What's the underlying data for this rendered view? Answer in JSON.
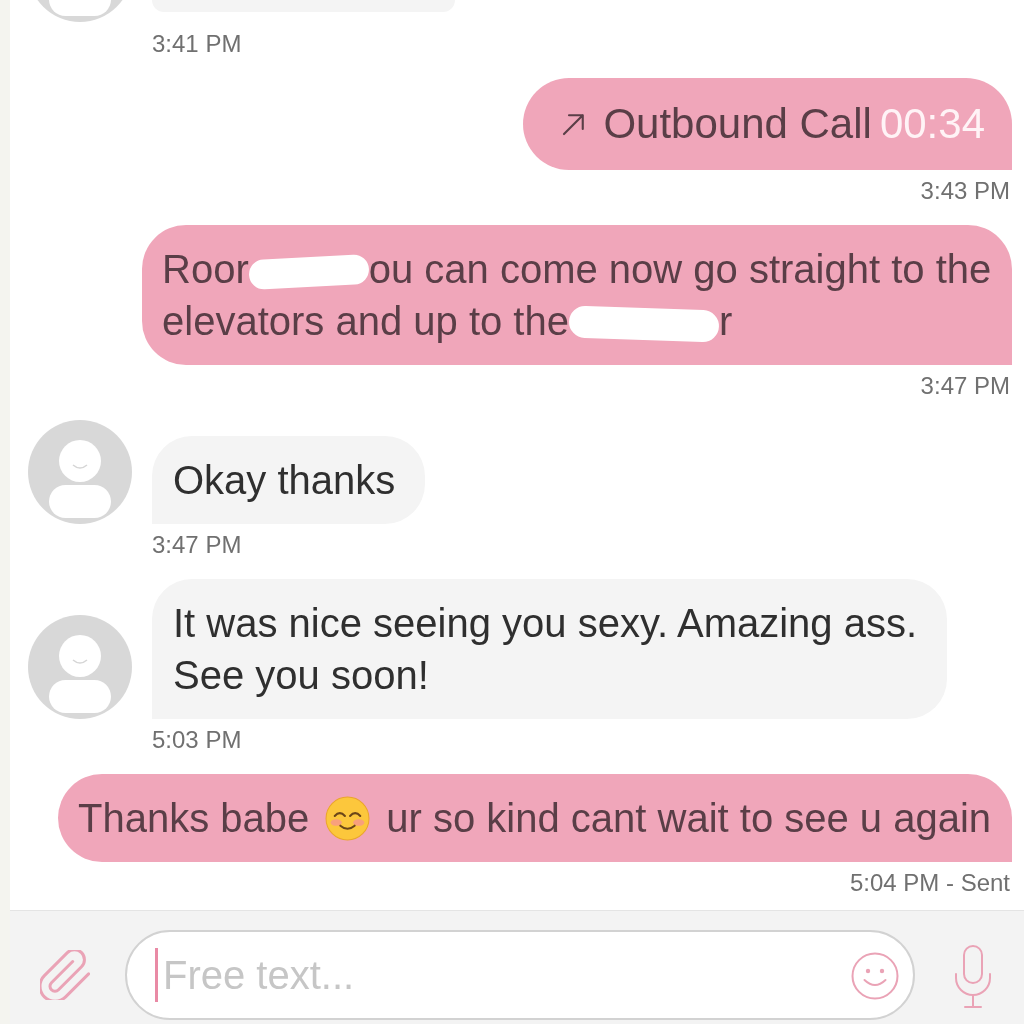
{
  "conversation": {
    "messages": [
      {
        "outgoing": false,
        "kind": "clipped",
        "time": "3:41 PM"
      },
      {
        "outgoing": true,
        "kind": "call",
        "label": "Outbound Call",
        "duration": "00:34",
        "time": "3:43 PM"
      },
      {
        "outgoing": true,
        "kind": "text",
        "segments": [
          {
            "kind": "text",
            "text": "Roor"
          },
          {
            "kind": "redaction"
          },
          {
            "kind": "text",
            "text": "ou can come now go straight to the"
          },
          {
            "kind": "text",
            "text": "elevators and up to the"
          },
          {
            "kind": "redaction"
          },
          {
            "kind": "text",
            "text": "r"
          }
        ],
        "time": "3:47 PM"
      },
      {
        "outgoing": false,
        "kind": "text",
        "segments": [
          {
            "kind": "text",
            "text": "Okay thanks"
          }
        ],
        "time": "3:47 PM"
      },
      {
        "outgoing": false,
        "kind": "text",
        "segments": [
          {
            "kind": "text",
            "text": "It was nice seeing you sexy. Amazing ass. See you soon!"
          }
        ],
        "time": "5:03 PM"
      },
      {
        "outgoing": true,
        "kind": "text",
        "segments": [
          {
            "kind": "text",
            "text": "Thanks babe"
          },
          {
            "kind": "emoji"
          },
          {
            "kind": "text",
            "text": "ur so kind cant wait to see u again"
          }
        ],
        "time": "5:04 PM - Sent"
      }
    ]
  },
  "composer": {
    "placeholder": "Free text..."
  }
}
